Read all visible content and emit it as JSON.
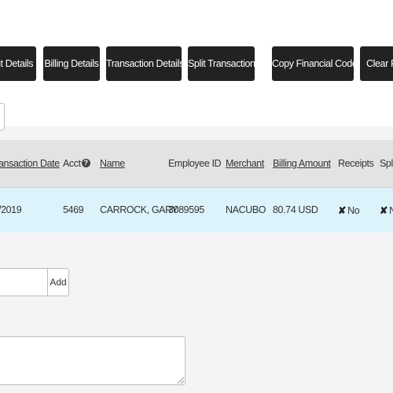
{
  "toolbar": {
    "buttons": [
      {
        "label": "nt Details"
      },
      {
        "label": "Billing Details"
      },
      {
        "label": "Transaction Details"
      },
      {
        "label": "Split Transaction"
      },
      {
        "label": "Copy Financial Codes"
      },
      {
        "label": "Clear Fi"
      }
    ]
  },
  "table": {
    "columns": [
      {
        "label": "ansaction Date"
      },
      {
        "label": "Acct"
      },
      {
        "label": "Name"
      },
      {
        "label": "Employee ID"
      },
      {
        "label": "Merchant"
      },
      {
        "label": "Billing Amount"
      },
      {
        "label": "Receipts"
      },
      {
        "label": "Spli"
      }
    ],
    "row": {
      "date": "/2019",
      "acct": "5469",
      "name": "CARROCK, GARY",
      "employee_id": "3089595",
      "merchant": "NACUBO",
      "billing_amount": "80.74 USD",
      "receipts": "No",
      "split": "N"
    }
  },
  "add_form": {
    "add_label": "Add"
  },
  "icons": {
    "help": "question-circle-icon",
    "no": "x-icon"
  },
  "colors": {
    "button_bg": "#222222",
    "row_highlight": "#ddf3fb",
    "header_bg": "#e3e3e5"
  }
}
